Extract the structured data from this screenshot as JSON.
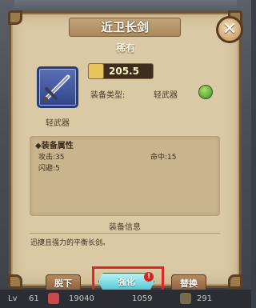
{
  "item": {
    "name": "近卫长剑",
    "rarity": "稀有",
    "power": "205.5",
    "caption": "轻武器",
    "type_label": "装备类型:",
    "type_value": "轻武器"
  },
  "attributes": {
    "title": "◆装备属性",
    "attack": "攻击:35",
    "hit": "命中:15",
    "dodge": "闪避:5"
  },
  "info": {
    "title": "装备信息",
    "text": "迅捷且强力的平衡长剑。"
  },
  "buttons": {
    "unequip": "脱下",
    "enhance": "强化",
    "replace": "替换",
    "badge": "!"
  },
  "bottom_bar": {
    "level_label": "Lv",
    "level": "61",
    "coins": "19040",
    "gems": "1059",
    "points": "291"
  },
  "close_glyph": "✕"
}
